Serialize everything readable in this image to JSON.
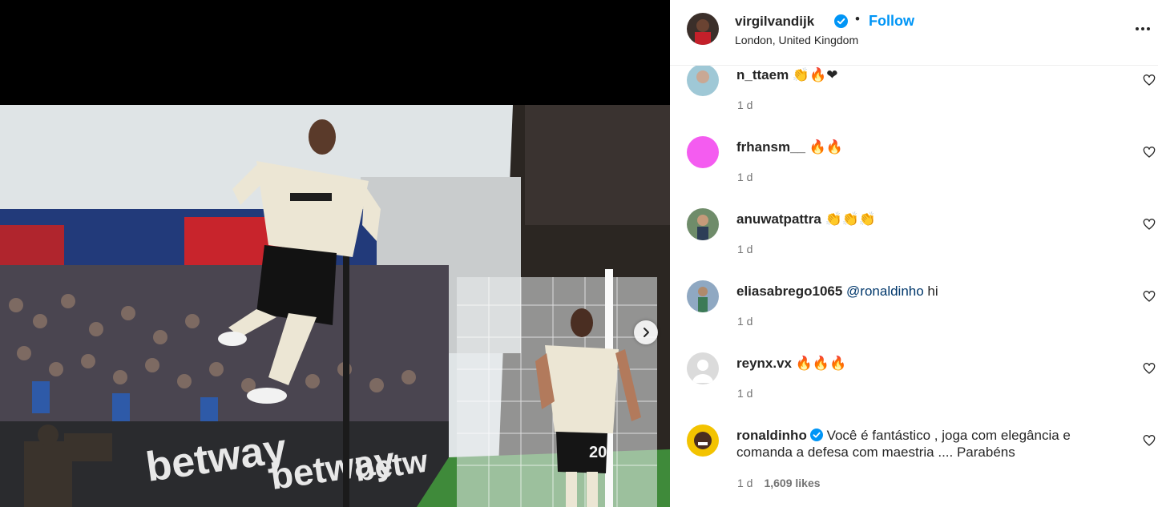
{
  "post": {
    "username": "virgilvandijk",
    "location": "London, United Kingdom",
    "follow_label": "Follow",
    "separator": "•"
  },
  "photo": {
    "banners": [
      "betway",
      "betway",
      "betw"
    ],
    "jersey_number": "20"
  },
  "comments": [
    {
      "username": "n_ttaem",
      "text": "👏🔥❤",
      "age": "1 d",
      "avatar_color": "#9fc8d6"
    },
    {
      "username": "frhansm__",
      "text": "🔥🔥",
      "age": "1 d",
      "avatar_color": "#f45cf0"
    },
    {
      "username": "anuwatpattra",
      "text": "👏👏👏",
      "age": "1 d",
      "avatar_color": "#6f8c6a"
    },
    {
      "username": "eliasabrego1065",
      "mention": "@ronaldinho",
      "text": " hi",
      "age": "1 d",
      "avatar_color": "#8fa8c2"
    },
    {
      "username": "reynx.vx",
      "text": "🔥🔥🔥",
      "age": "1 d",
      "avatar_color": "#dbdbdb"
    },
    {
      "username": "ronaldinho",
      "verified": true,
      "text": "Você é fantástico , joga com elegância e comanda a defesa com maestria .... Parabéns",
      "age": "1 d",
      "likes": "1,609 likes",
      "avatar_color": "#f3c300"
    }
  ],
  "colors": {
    "accent": "#0095f6",
    "verified": "#0095f6",
    "mention": "#00376b",
    "muted": "#737373"
  },
  "icons": [
    "verified-badge-icon",
    "more-options-icon",
    "heart-icon",
    "chevron-right-icon"
  ]
}
